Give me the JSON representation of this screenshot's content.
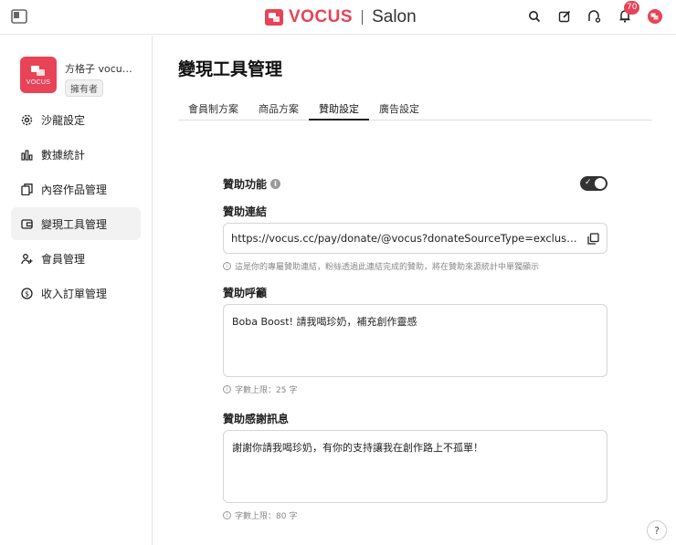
{
  "brand": {
    "name": "VOCUS",
    "product": "Salon"
  },
  "topbar": {
    "notification_count": "70"
  },
  "salon": {
    "logo_text": "VOCUS",
    "name": "方格子 vocus…",
    "role": "擁有者"
  },
  "sidebar": {
    "items": [
      {
        "label": "沙龍設定",
        "icon": "gear-icon"
      },
      {
        "label": "數據統計",
        "icon": "bar-chart-icon"
      },
      {
        "label": "內容作品管理",
        "icon": "documents-icon"
      },
      {
        "label": "變現工具管理",
        "icon": "wallet-icon",
        "active": true
      },
      {
        "label": "會員管理",
        "icon": "users-icon"
      },
      {
        "label": "收入訂單管理",
        "icon": "dollar-icon"
      }
    ]
  },
  "page": {
    "title": "變現工具管理",
    "tabs": [
      "會員制方案",
      "商品方案",
      "贊助設定",
      "廣告設定"
    ],
    "active_tab": "贊助設定"
  },
  "sponsor": {
    "feature_label": "贊助功能",
    "enabled": true,
    "link_label": "贊助連結",
    "link_value": "https://vocus.cc/pay/donate/@vocus?donateSourceType=exclusive_link",
    "link_hint": "這是你的專屬贊助連結，粉絲透過此連結完成的贊助，將在贊助來源統計中單獨顯示",
    "call_label": "贊助呼籲",
    "call_value": "Boba Boost! 請我喝珍奶，補充創作靈感",
    "call_hint": "字數上限：25 字",
    "thanks_label": "贊助感謝訊息",
    "thanks_value": "謝謝你請我喝珍奶，有你的支持讓我在創作路上不孤單！",
    "thanks_hint": "字數上限：80 字"
  },
  "colors": {
    "brand": "#e84357",
    "switch_on": "#333333"
  }
}
